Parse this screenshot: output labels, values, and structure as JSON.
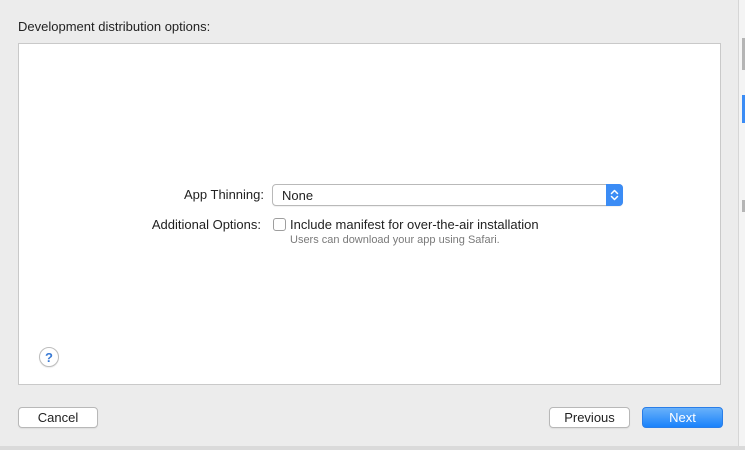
{
  "dialog": {
    "title": "Development distribution options:"
  },
  "form": {
    "app_thinning_label": "App Thinning:",
    "app_thinning_value": "None",
    "additional_options_label": "Additional Options:",
    "manifest_checkbox_label": "Include manifest for over-the-air installation",
    "manifest_checked": false,
    "manifest_hint": "Users can download your app using Safari."
  },
  "help": {
    "glyph": "?",
    "icon": "question-mark-icon"
  },
  "buttons": {
    "cancel": "Cancel",
    "previous": "Previous",
    "next": "Next"
  },
  "colors": {
    "accent": "#3b8cf5",
    "primary_button": "#1a82fb"
  }
}
